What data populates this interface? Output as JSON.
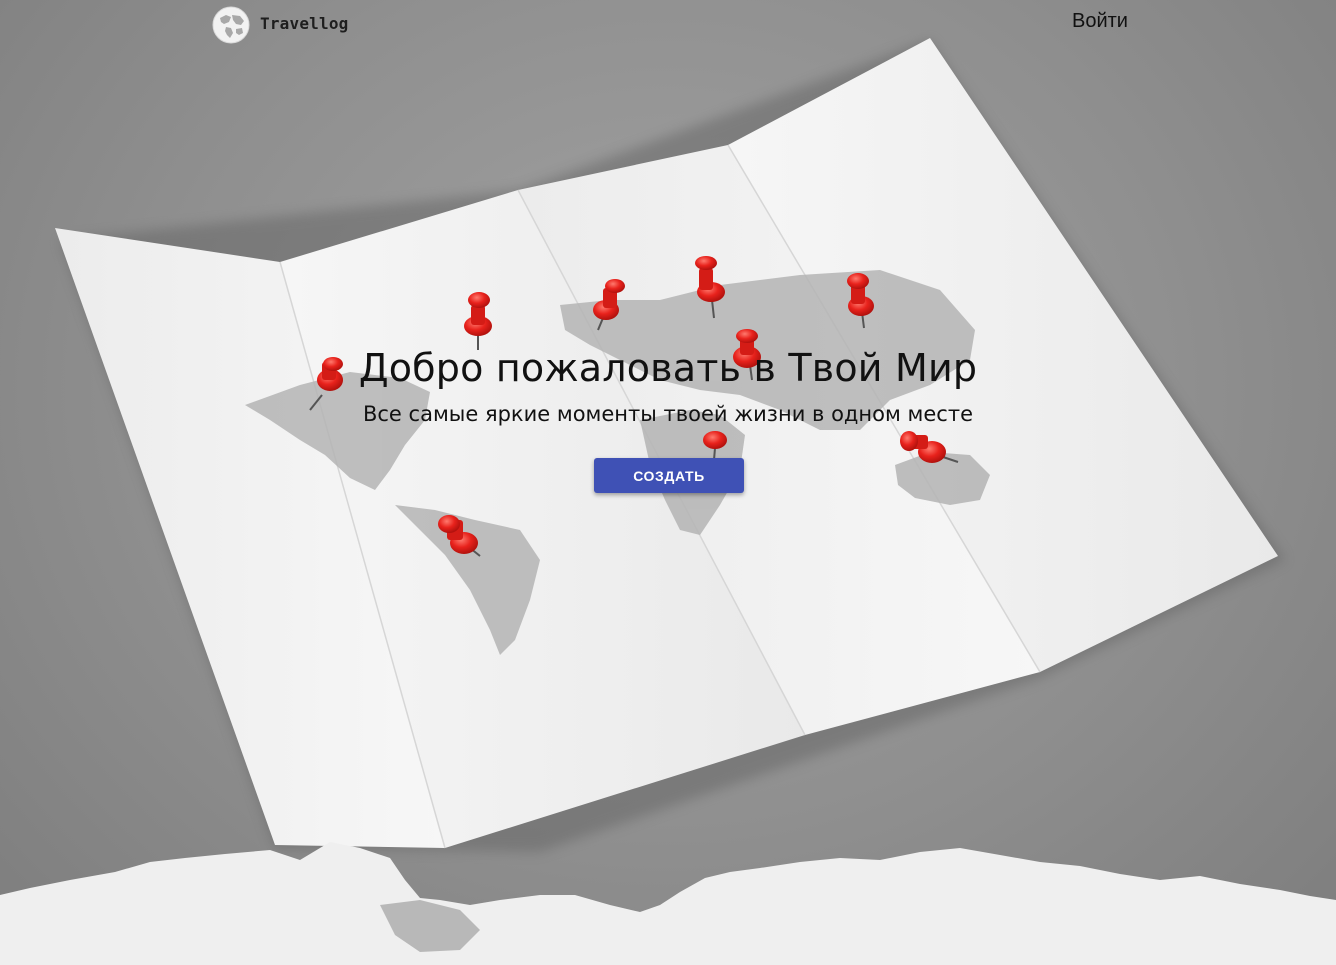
{
  "header": {
    "logo_text": "Travellog",
    "login_label": "Войти"
  },
  "hero": {
    "title": "Добро пожаловать в Твой Мир",
    "subtitle": "Все самые яркие моменты твоей жизни в одном месте",
    "create_button_label": "СОЗДАТЬ"
  },
  "icons": {
    "logo": "globe-icon",
    "pins": "pushpin-icon"
  },
  "colors": {
    "primary_button": "#3f51b5",
    "pin_red": "#e8221c",
    "background_gray": "#8f8f8f",
    "paper": "#f2f2f2"
  }
}
